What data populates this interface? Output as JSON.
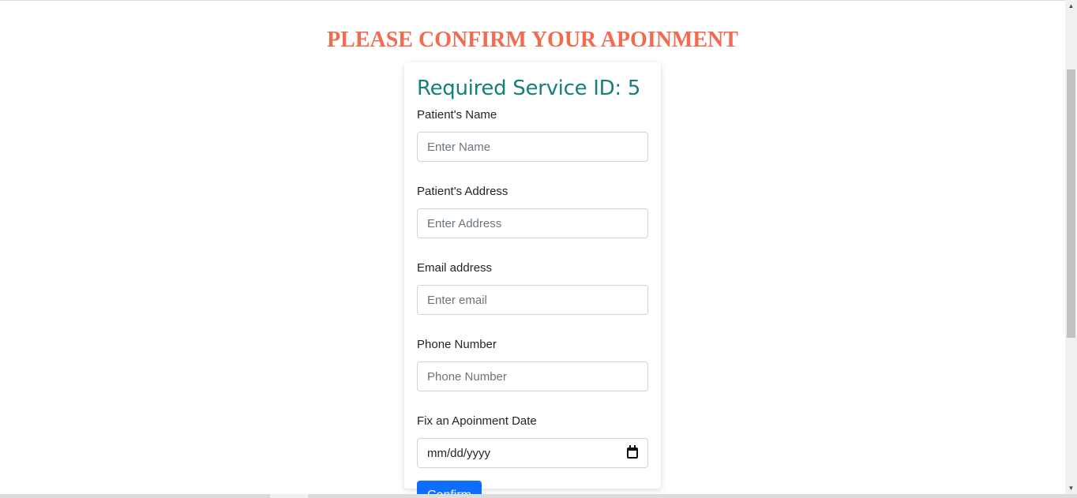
{
  "page": {
    "heading": "PLEASE CONFIRM YOUR APOINMENT"
  },
  "card": {
    "title": "Required Service ID: 5"
  },
  "form": {
    "name": {
      "label": "Patient's Name",
      "placeholder": "Enter Name"
    },
    "address": {
      "label": "Patient's Address",
      "placeholder": "Enter Address"
    },
    "email": {
      "label": "Email address",
      "placeholder": "Enter email"
    },
    "phone": {
      "label": "Phone Number",
      "placeholder": "Phone Number"
    },
    "date": {
      "label": "Fix an Apoinment Date",
      "placeholder": "mm/dd/yyyy",
      "icon": "calendar-icon"
    },
    "confirm_label": "Confirm"
  },
  "colors": {
    "heading": "#f26b4f",
    "title": "#157f7a",
    "button": "#0d6efd"
  }
}
